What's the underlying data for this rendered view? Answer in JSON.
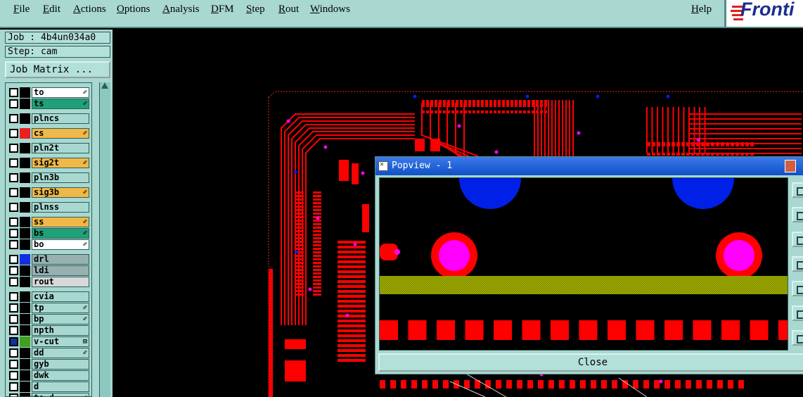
{
  "menu": {
    "items": [
      "File",
      "Edit",
      "Actions",
      "Options",
      "Analysis",
      "DFM",
      "Step",
      "Rout",
      "Windows"
    ],
    "help": "Help"
  },
  "logo": {
    "text": "Fronti"
  },
  "job": {
    "label": "Job : 4b4un034a0",
    "step": "Step: cam",
    "matrix_button": "Job Matrix ..."
  },
  "layers": [
    {
      "name": "to",
      "bg": "#ffffff",
      "color": "#000000",
      "mark": "✐"
    },
    {
      "name": "ts",
      "bg": "#20a078",
      "color": "#000000",
      "mark": "✐"
    },
    {
      "name": "plncs",
      "bg": "#a8d8d0",
      "color": "#000000",
      "mark": ""
    },
    {
      "name": "cs",
      "bg": "#f0b848",
      "color": "#e82020",
      "mark": "✐"
    },
    {
      "name": "pln2t",
      "bg": "#a8d8d0",
      "color": "#000000",
      "mark": ""
    },
    {
      "name": "sig2t",
      "bg": "#f0b848",
      "color": "#000000",
      "mark": "✐"
    },
    {
      "name": "pln3b",
      "bg": "#a8d8d0",
      "color": "#000000",
      "mark": ""
    },
    {
      "name": "sig3b",
      "bg": "#f0b848",
      "color": "#000000",
      "mark": "✐"
    },
    {
      "name": "plnss",
      "bg": "#a8d8d0",
      "color": "#000000",
      "mark": ""
    },
    {
      "name": "ss",
      "bg": "#f0b848",
      "color": "#000000",
      "mark": "✐"
    },
    {
      "name": "bs",
      "bg": "#20a078",
      "color": "#000000",
      "mark": "✐"
    },
    {
      "name": "bo",
      "bg": "#ffffff",
      "color": "#000000",
      "mark": "✐"
    },
    {
      "name": "drl",
      "bg": "#98b0b0",
      "color": "#1030e0",
      "mark": ""
    },
    {
      "name": "ldi",
      "bg": "#98b0b0",
      "color": "#000000",
      "mark": ""
    },
    {
      "name": "rout",
      "bg": "#d8d8d8",
      "color": "#000000",
      "mark": ""
    },
    {
      "name": "cvia",
      "bg": "#a8d8d0",
      "color": "#000000",
      "mark": ""
    },
    {
      "name": "tp",
      "bg": "#a8d8d0",
      "color": "#000000",
      "mark": "✐"
    },
    {
      "name": "bp",
      "bg": "#a8d8d0",
      "color": "#000000",
      "mark": "✐"
    },
    {
      "name": "npth",
      "bg": "#a8d8d0",
      "color": "#000000",
      "mark": ""
    },
    {
      "name": "v-cut",
      "bg": "#a8d8d0",
      "color": "#40a020",
      "mark": "⊞"
    },
    {
      "name": "dd",
      "bg": "#a8d8d0",
      "color": "#000000",
      "mark": "✐"
    },
    {
      "name": "gyb",
      "bg": "#a8d8d0",
      "color": "#000000",
      "mark": ""
    },
    {
      "name": "dwk",
      "bg": "#a8d8d0",
      "color": "#000000",
      "mark": ""
    },
    {
      "name": "d",
      "bg": "#a8d8d0",
      "color": "#000000",
      "mark": ""
    },
    {
      "name": "to-d",
      "bg": "#a8d8d0",
      "color": "#000000",
      "mark": "✐"
    }
  ],
  "popview": {
    "title": "Popview - 1",
    "close": "Close"
  },
  "colors": {
    "copper": "#ff0000",
    "via": "#ff00ff",
    "drill": "#0020e8",
    "silk": "#9a9a00",
    "ui": "#a8d8d0"
  },
  "icons": [
    "edit-pencil-icon",
    "scroll-up-arrow-icon",
    "popview-window-icon",
    "zoom-icon"
  ]
}
